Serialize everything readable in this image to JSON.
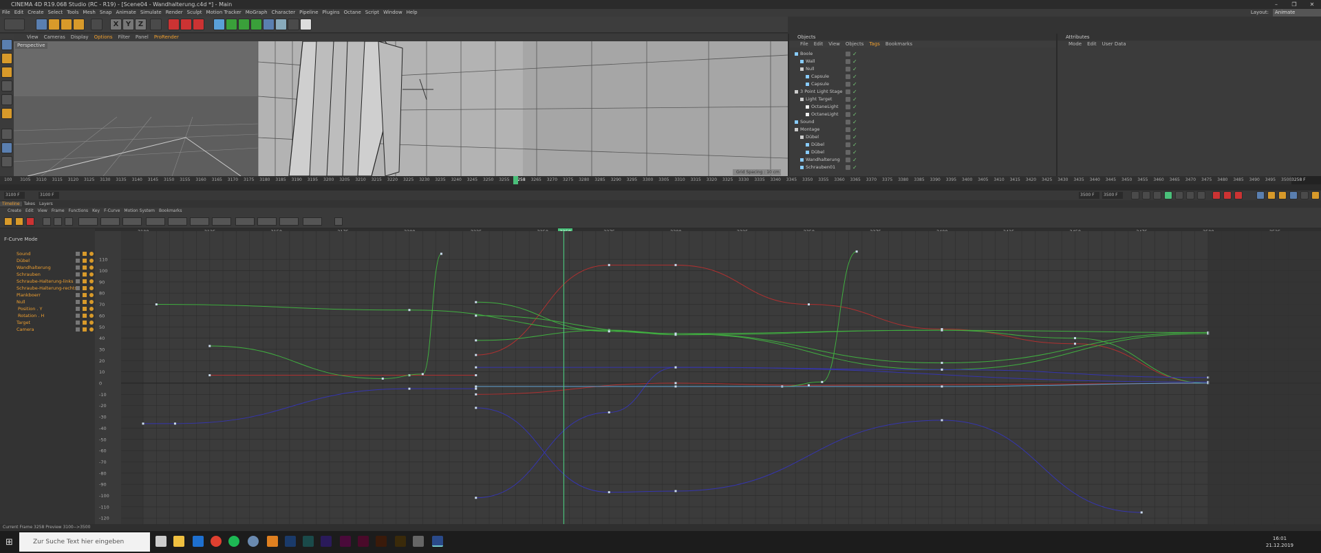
{
  "window": {
    "title": "CINEMA 4D R19.068 Studio (RC - R19) - [Scene04 - Wandhalterung.c4d *] - Main",
    "minimize": "–",
    "maximize": "❐",
    "close": "✕"
  },
  "menu": [
    "File",
    "Edit",
    "Create",
    "Select",
    "Tools",
    "Mesh",
    "Snap",
    "Animate",
    "Simulate",
    "Render",
    "Sculpt",
    "Motion Tracker",
    "MoGraph",
    "Character",
    "Pipeline",
    "Plugins",
    "Octane",
    "Script",
    "Window",
    "Help"
  ],
  "layout": {
    "label": "Layout:",
    "value": "Animate"
  },
  "toolbar": {
    "axis_x": "X",
    "axis_y": "Y",
    "axis_z": "Z"
  },
  "viewport": {
    "menu": [
      "View",
      "Cameras",
      "Display",
      "Options",
      "Filter",
      "Panel",
      "ProRender"
    ],
    "label": "Perspective",
    "grid_spacing": "Grid Spacing : 10 cm"
  },
  "timeline_ruler": {
    "ticks": [
      "100",
      "3105",
      "3110",
      "3115",
      "3120",
      "3125",
      "3130",
      "3135",
      "3140",
      "3145",
      "3150",
      "3155",
      "3160",
      "3165",
      "3170",
      "3175",
      "3180",
      "3185",
      "3190",
      "3195",
      "3200",
      "3205",
      "3210",
      "3215",
      "3220",
      "3225",
      "3230",
      "3235",
      "3240",
      "3245",
      "3250",
      "3255",
      "3258",
      "3265",
      "3270",
      "3275",
      "3280",
      "3285",
      "3290",
      "3295",
      "3300",
      "3305",
      "3310",
      "3315",
      "3320",
      "3325",
      "3330",
      "3335",
      "3340",
      "3345",
      "3350",
      "3355",
      "3360",
      "3365",
      "3370",
      "3375",
      "3380",
      "3385",
      "3390",
      "3395",
      "3400",
      "3405",
      "3410",
      "3415",
      "3420",
      "3425",
      "3430",
      "3435",
      "3440",
      "3445",
      "3450",
      "3455",
      "3460",
      "3465",
      "3470",
      "3475",
      "3480",
      "3485",
      "3490",
      "3495",
      "3500"
    ],
    "current_frame_field": "3258 F"
  },
  "timeline_ctrl": {
    "start": "3100 F",
    "start2": "3100 F",
    "end": "3500 F",
    "end2": "3500 F"
  },
  "objects_panel": {
    "header": "Objects",
    "menu": [
      "File",
      "Edit",
      "View",
      "Objects",
      "Tags",
      "Bookmarks"
    ],
    "items": [
      {
        "name": "Boole",
        "indent": 0
      },
      {
        "name": "Wall",
        "indent": 1
      },
      {
        "name": "Null",
        "indent": 1
      },
      {
        "name": "Capsule",
        "indent": 2
      },
      {
        "name": "Capsule",
        "indent": 2
      },
      {
        "name": "3 Point Light Stage",
        "indent": 0
      },
      {
        "name": "Light Target",
        "indent": 1
      },
      {
        "name": "OctaneLight",
        "indent": 2
      },
      {
        "name": "OctaneLight",
        "indent": 2
      },
      {
        "name": "Sound",
        "indent": 0
      },
      {
        "name": "Montage",
        "indent": 0
      },
      {
        "name": "Dübel",
        "indent": 1
      },
      {
        "name": "Dübel",
        "indent": 2
      },
      {
        "name": "Dübel",
        "indent": 2
      },
      {
        "name": "Wandhalterung",
        "indent": 1
      },
      {
        "name": "Schrauben01",
        "indent": 1
      }
    ]
  },
  "attributes_panel": {
    "header": "Attributes",
    "menu": [
      "Mode",
      "Edit",
      "User Data"
    ]
  },
  "tabs": [
    "Timeline",
    "Takes",
    "Layers"
  ],
  "fcurve_menu": [
    "Create",
    "Edit",
    "View",
    "Frame",
    "Functions",
    "Key",
    "F-Curve",
    "Motion System",
    "Bookmarks"
  ],
  "fcurve_mode": "F-Curve Mode",
  "tracks": [
    {
      "name": "Sound",
      "indent": 0
    },
    {
      "name": "Dübel",
      "indent": 0
    },
    {
      "name": "Wandhalterung",
      "indent": 0
    },
    {
      "name": "Schrauben",
      "indent": 0
    },
    {
      "name": "Schraube-Halterung-links",
      "indent": 0
    },
    {
      "name": "Schraube-Halterung-rechts",
      "indent": 0
    },
    {
      "name": "Plankboerr",
      "indent": 0
    },
    {
      "name": "Null",
      "indent": 0
    },
    {
      "name": "Position . Y",
      "indent": 1
    },
    {
      "name": "Rotation . H",
      "indent": 1
    },
    {
      "name": "Target",
      "indent": 0
    },
    {
      "name": "Camera",
      "indent": 0
    }
  ],
  "graph_ruler": [
    "3100",
    "3125",
    "3150",
    "3175",
    "3200",
    "3225",
    "3250",
    "3258",
    "3275",
    "3300",
    "3325",
    "3350",
    "3375",
    "3400",
    "3425",
    "3450",
    "3475",
    "3500",
    "3525"
  ],
  "graph_yaxis": [
    "110",
    "100",
    "90",
    "80",
    "70",
    "60",
    "50",
    "40",
    "30",
    "20",
    "10",
    "0",
    "-10",
    "-20",
    "-30",
    "-40",
    "-50",
    "-60",
    "-70",
    "-80",
    "-90",
    "-100",
    "-110",
    "-120"
  ],
  "status": {
    "text": "Current Frame  3258  Preview  3100-->3500"
  },
  "taskbar": {
    "search_placeholder": "Zur Suche Text hier eingeben",
    "time": "16:01",
    "date": "21.12.2019"
  }
}
